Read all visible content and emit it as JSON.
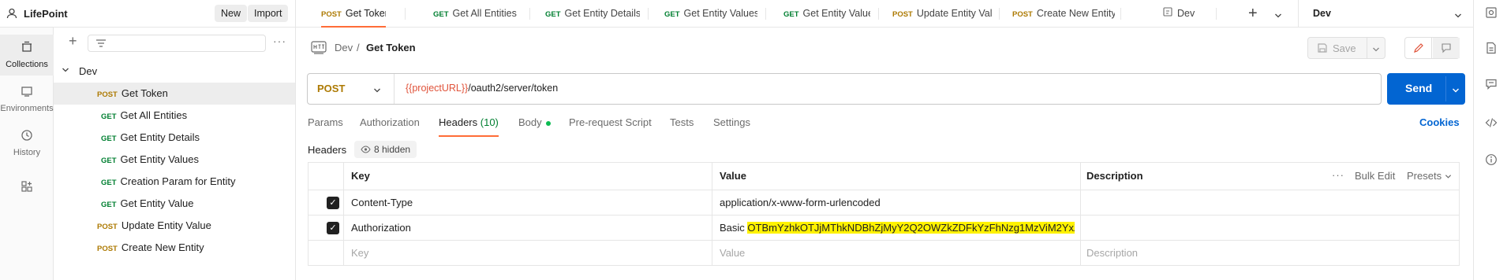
{
  "workspace": {
    "name": "LifePoint",
    "new_label": "New",
    "import_label": "Import"
  },
  "rail": [
    {
      "label": "Collections",
      "icon": "collections-icon"
    },
    {
      "label": "Environments",
      "icon": "environments-icon"
    },
    {
      "label": "History",
      "icon": "history-icon"
    }
  ],
  "sidebar": {
    "collection": "Dev",
    "items": [
      {
        "method": "POST",
        "name": "Get Token"
      },
      {
        "method": "GET",
        "name": "Get All Entities"
      },
      {
        "method": "GET",
        "name": "Get Entity Details"
      },
      {
        "method": "GET",
        "name": "Get Entity Values"
      },
      {
        "method": "GET",
        "name": "Creation Param for Entity"
      },
      {
        "method": "GET",
        "name": "Get Entity Value"
      },
      {
        "method": "POST",
        "name": "Update Entity Value"
      },
      {
        "method": "POST",
        "name": "Create New Entity"
      }
    ]
  },
  "tabs": [
    {
      "method": "POST",
      "name": "Get Token"
    },
    {
      "method": "GET",
      "name": "Get All Entities"
    },
    {
      "method": "GET",
      "name": "Get Entity Details"
    },
    {
      "method": "GET",
      "name": "Get Entity Values"
    },
    {
      "method": "GET",
      "name": "Get Entity Value"
    },
    {
      "method": "POST",
      "name": "Update Entity Value"
    },
    {
      "method": "POST",
      "name": "Create New Entity"
    },
    {
      "method": "",
      "name": "Dev"
    }
  ],
  "environment": "Dev",
  "breadcrumb": {
    "collection": "Dev",
    "sep": "/",
    "request": "Get Token"
  },
  "save_label": "Save",
  "request": {
    "method": "POST",
    "url_var": "{{projectURL}}",
    "url_path": "/oauth2/server/token",
    "send_label": "Send"
  },
  "subtabs": {
    "params": "Params",
    "authorization": "Authorization",
    "headers": "Headers",
    "headers_count": "(10)",
    "body": "Body",
    "prerequest": "Pre-request Script",
    "tests": "Tests",
    "settings": "Settings",
    "cookies": "Cookies"
  },
  "headers_section": {
    "title": "Headers",
    "hidden": "8 hidden"
  },
  "table": {
    "col_key": "Key",
    "col_value": "Value",
    "col_description": "Description",
    "bulk_edit": "Bulk Edit",
    "presets": "Presets",
    "rows": [
      {
        "key": "Content-Type",
        "value_prefix": "",
        "value": "application/x-www-form-urlencoded"
      },
      {
        "key": "Authorization",
        "value_prefix": "Basic ",
        "value": "OTBmYzhkOTJjMThkNDBhZjMyY2Q2OWZkZDFkYzFhNzg1MzViM2YxZD..."
      }
    ],
    "placeholder_key": "Key",
    "placeholder_value": "Value",
    "placeholder_description": "Description"
  },
  "colors": {
    "get": "#007f31",
    "post": "#ad7a03",
    "accent": "#ff6c37",
    "send": "#0265d2",
    "highlight": "#fff200"
  }
}
